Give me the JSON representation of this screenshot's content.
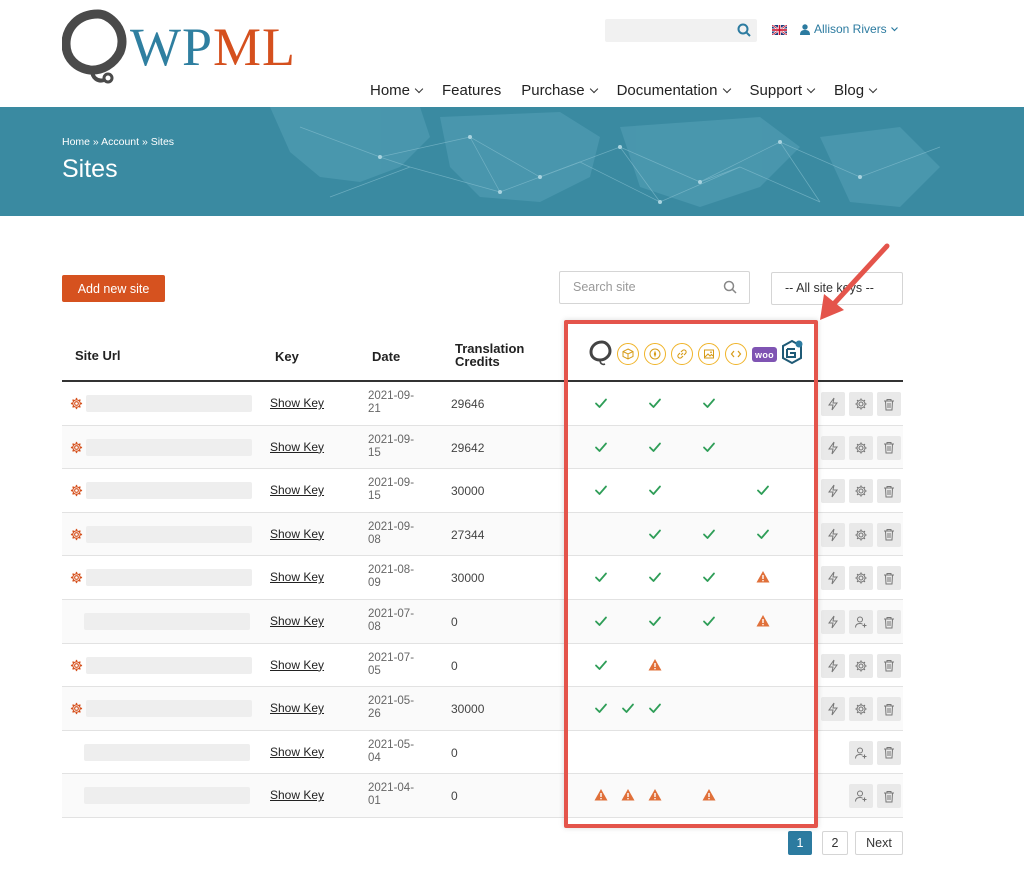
{
  "header": {
    "logo_text": "WPML",
    "user_name": "Allison Rivers",
    "nav": [
      {
        "label": "Home",
        "has_dropdown": true
      },
      {
        "label": "Features",
        "has_dropdown": false
      },
      {
        "label": "Purchase",
        "has_dropdown": true
      },
      {
        "label": "Documentation",
        "has_dropdown": true
      },
      {
        "label": "Support",
        "has_dropdown": true
      },
      {
        "label": "Blog",
        "has_dropdown": true
      }
    ]
  },
  "banner": {
    "breadcrumb": "Home » Account » Sites",
    "title": "Sites"
  },
  "controls": {
    "add_button": "Add new site",
    "search_placeholder": "Search site",
    "key_filter": "-- All site keys --"
  },
  "table": {
    "headers": {
      "site_url": "Site Url",
      "key": "Key",
      "date": "Date",
      "credits_line1": "Translation",
      "credits_line2": "Credits"
    },
    "plugin_icons": [
      "wpml-logo-icon",
      "box-icon",
      "compass-icon",
      "link-icon",
      "image-icon",
      "code-icon",
      "woo-icon",
      "translation-management-icon"
    ],
    "woo_label": "woo",
    "rows": [
      {
        "has_gear": true,
        "show_key": "Show Key",
        "date_line1": "2021-09-",
        "date_line2": "21",
        "credits": "29646",
        "status": [
          "check",
          "",
          "check",
          "",
          "check",
          "",
          "",
          ""
        ],
        "actions": [
          "bolt",
          "settings",
          "trash"
        ]
      },
      {
        "has_gear": true,
        "show_key": "Show Key",
        "date_line1": "2021-09-",
        "date_line2": "15",
        "credits": "29642",
        "status": [
          "check",
          "",
          "check",
          "",
          "check",
          "",
          "",
          ""
        ],
        "actions": [
          "bolt",
          "settings",
          "trash"
        ]
      },
      {
        "has_gear": true,
        "show_key": "Show Key",
        "date_line1": "2021-09-",
        "date_line2": "15",
        "credits": "30000",
        "status": [
          "check",
          "",
          "check",
          "",
          "",
          "",
          "check",
          ""
        ],
        "actions": [
          "bolt",
          "settings",
          "trash"
        ]
      },
      {
        "has_gear": true,
        "show_key": "Show Key",
        "date_line1": "2021-09-",
        "date_line2": "08",
        "credits": "27344",
        "status": [
          "",
          "",
          "check",
          "",
          "check",
          "",
          "check",
          ""
        ],
        "actions": [
          "bolt",
          "settings",
          "trash"
        ]
      },
      {
        "has_gear": true,
        "show_key": "Show Key",
        "date_line1": "2021-08-",
        "date_line2": "09",
        "credits": "30000",
        "status": [
          "check",
          "",
          "check",
          "",
          "check",
          "",
          "warn",
          ""
        ],
        "actions": [
          "bolt",
          "settings",
          "trash"
        ]
      },
      {
        "has_gear": false,
        "show_key": "Show Key",
        "date_line1": "2021-07-",
        "date_line2": "08",
        "credits": "0",
        "status": [
          "check",
          "",
          "check",
          "",
          "check",
          "",
          "warn",
          ""
        ],
        "actions": [
          "bolt",
          "add-user",
          "trash"
        ]
      },
      {
        "has_gear": true,
        "show_key": "Show Key",
        "date_line1": "2021-07-",
        "date_line2": "05",
        "credits": "0",
        "status": [
          "check",
          "",
          "warn",
          "",
          "",
          "",
          "",
          ""
        ],
        "actions": [
          "bolt",
          "settings",
          "trash"
        ]
      },
      {
        "has_gear": true,
        "show_key": "Show Key",
        "date_line1": "2021-05-",
        "date_line2": "26",
        "credits": "30000",
        "status": [
          "check",
          "check",
          "check",
          "",
          "",
          "",
          "",
          ""
        ],
        "actions": [
          "bolt",
          "settings",
          "trash"
        ]
      },
      {
        "has_gear": false,
        "show_key": "Show Key",
        "date_line1": "2021-05-",
        "date_line2": "04",
        "credits": "0",
        "status": [
          "",
          "",
          "",
          "",
          "",
          "",
          "",
          ""
        ],
        "actions": [
          "add-user",
          "trash"
        ]
      },
      {
        "has_gear": false,
        "show_key": "Show Key",
        "date_line1": "2021-04-",
        "date_line2": "01",
        "credits": "0",
        "status": [
          "warn",
          "warn",
          "warn",
          "",
          "warn",
          "",
          "",
          ""
        ],
        "actions": [
          "add-user",
          "trash"
        ]
      }
    ]
  },
  "pagination": {
    "pages": [
      "1",
      "2"
    ],
    "active": "1",
    "next": "Next"
  },
  "colors": {
    "brand_blue": "#2c7ba0",
    "brand_orange": "#d6521f",
    "check_green": "#2f9e58",
    "warn_orange": "#e0703a",
    "annotation_red": "#e4544b"
  }
}
